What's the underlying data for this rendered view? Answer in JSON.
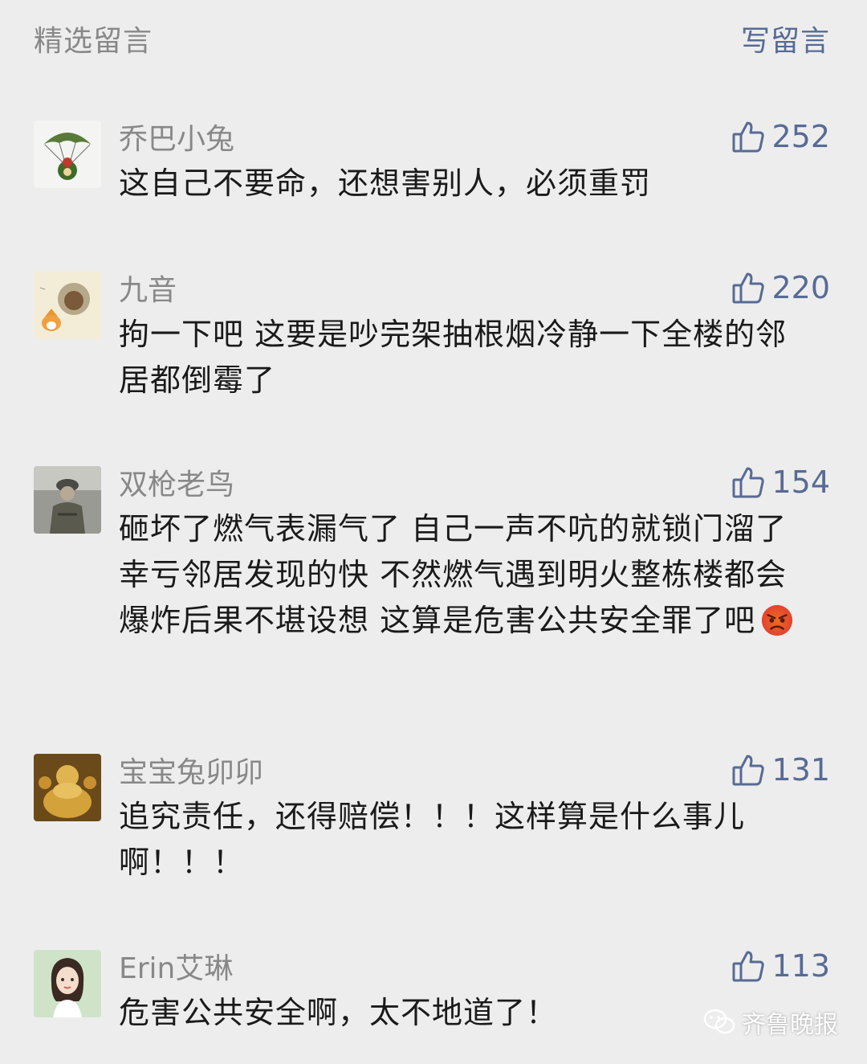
{
  "header": {
    "title": "精选留言",
    "write_label": "写留言"
  },
  "comments": [
    {
      "name": "乔巴小兔",
      "likes": "252",
      "text": "这自己不要命，还想害别人，必须重罚",
      "avatar": "parachute-avatar"
    },
    {
      "name": "九音",
      "likes": "220",
      "text": "拘一下吧 这要是吵完架抽根烟冷静一下全楼的邻居都倒霉了",
      "avatar": "cartoon-fox-avatar"
    },
    {
      "name": "双枪老鸟",
      "likes": "154",
      "text": "砸坏了燃气表漏气了 自己一声不吭的就锁门溜了 幸亏邻居发现的快 不然燃气遇到明火整栋楼都会爆炸后果不堪设想 这算是危害公共安全罪了吧",
      "emoji": "angry-face-icon",
      "avatar": "soldier-photo-avatar"
    },
    {
      "name": "宝宝兔卯卯",
      "likes": "131",
      "text": "追究责任，还得赔偿！！！这样算是什么事儿啊！！！",
      "avatar": "golden-buddha-avatar"
    },
    {
      "name": "Erin艾琳",
      "likes": "113",
      "text": "危害公共安全啊，太不地道了！",
      "avatar": "girl-illustration-avatar"
    }
  ],
  "watermark": {
    "text": "齐鲁晚报",
    "icon": "wechat-icon"
  },
  "colors": {
    "background": "#ededed",
    "link": "#576b95",
    "meta": "#888888",
    "text": "#1a1a1a"
  }
}
